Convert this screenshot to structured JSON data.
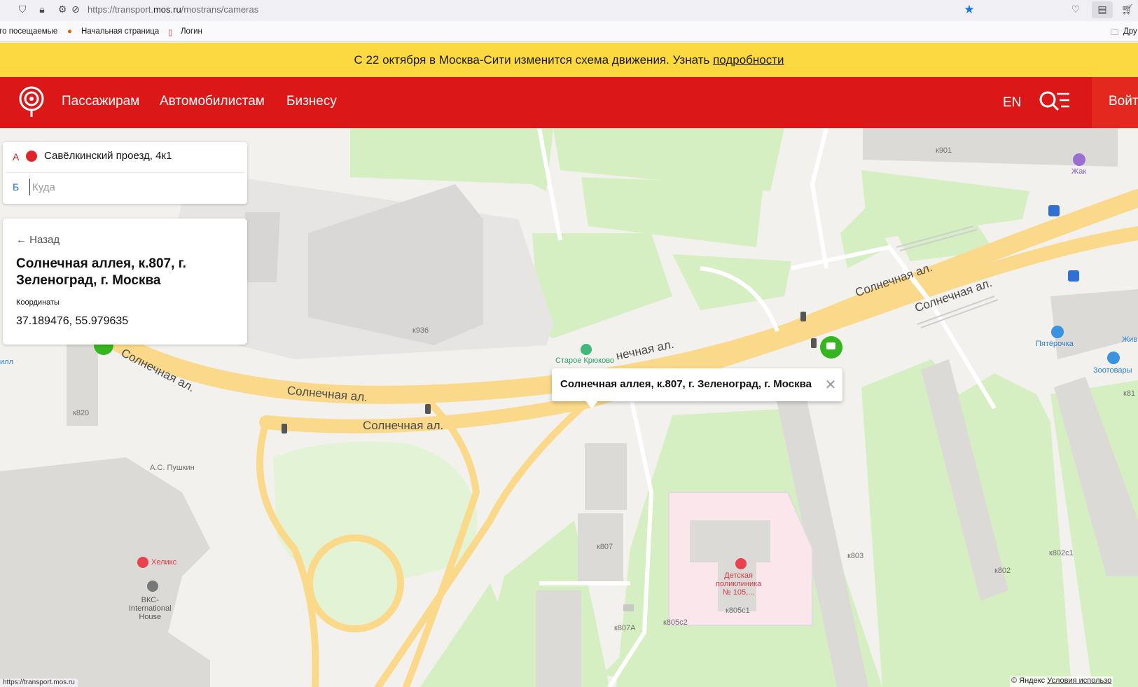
{
  "browser": {
    "url_prefix": "https://transport.",
    "url_domain": "mos.ru",
    "url_path": "/mostrans/cameras",
    "bookmarks": [
      "то посещаемые",
      "Начальная страница",
      "Логин",
      "Дру"
    ]
  },
  "announcement": {
    "text": "С 22 октября в Москва-Сити изменится схема движения. Узнать ",
    "link": "подробности"
  },
  "header": {
    "nav": [
      "Пассажирам",
      "Автомобилистам",
      "Бизнесу"
    ],
    "lang": "EN",
    "login": "Войт"
  },
  "route": {
    "a_letter": "А",
    "b_letter": "Б",
    "from_value": "Савёлкинский проезд, 4к1",
    "to_placeholder": "Куда"
  },
  "info": {
    "back": "← Назад",
    "title": "Солнечная аллея, к.807, г. Зеленоград, г. Москва",
    "coords_label": "Координаты",
    "coords_value": "37.189476, 55.979635"
  },
  "balloon": {
    "text": "Солнечная аллея, к.807, г. Зеленоград, г. Москва"
  },
  "map": {
    "streets": [
      "Солнечная ал.",
      "Солнечная ал.",
      "Солнечная ал.",
      "Солнечная ал.",
      "Солнечная ал.",
      "нечная ал."
    ],
    "buildings": [
      "к901",
      "к936",
      "к820",
      "к807",
      "к807А",
      "к805с2",
      "к805с1",
      "к803",
      "к802",
      "к802с1",
      "к81"
    ],
    "pois": [
      "Жак",
      "Старое Крюково",
      "Пятёрочка",
      "Жив",
      "Зоотовары",
      "А.С. Пушкин",
      "Хеликс",
      "ВКС-\nInternational\nHouse",
      "Детская\nполиклиника\n№ 105,...",
      "илл"
    ],
    "colors": {
      "road": "#fbd98a",
      "green": "#d6efc2",
      "building": "#dcdad6",
      "hospital": "#fbe6ec"
    }
  },
  "footer": {
    "copyright": "© Яндекс ",
    "terms": "Условия использо",
    "status_url": "https://transport.mos.ru"
  }
}
